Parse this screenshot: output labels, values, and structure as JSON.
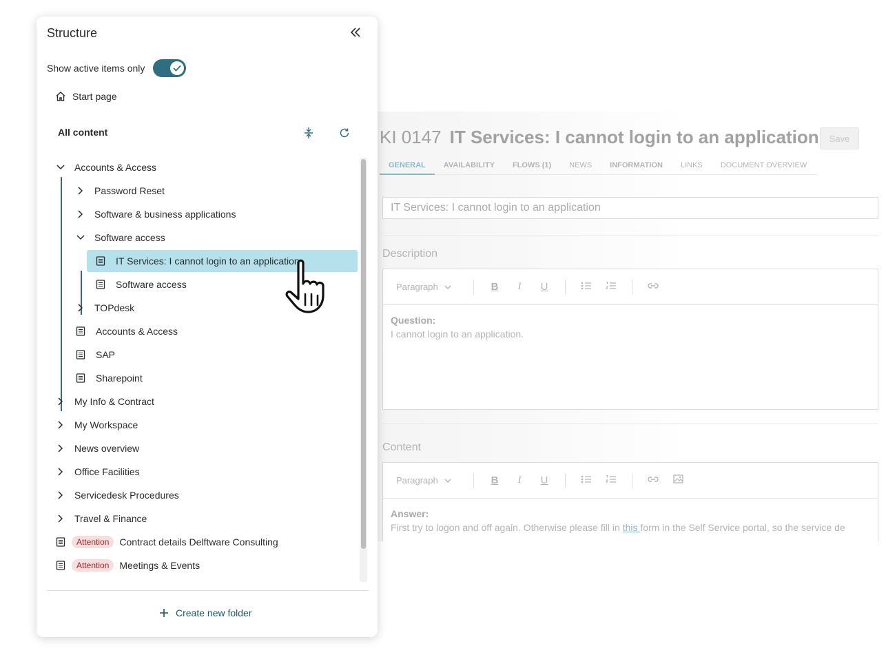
{
  "editor": {
    "id": "KI 0147",
    "title": "IT Services: I cannot login to an application",
    "save_label": "Save",
    "tabs": [
      "GENERAL",
      "AVAILABILITY",
      "FLOWS (1)",
      "NEWS",
      "INFORMATION",
      "LINKS",
      "DOCUMENT OVERVIEW"
    ],
    "title_field_value": "IT Services: I cannot login to an application",
    "description_label": "Description",
    "content_label": "Content",
    "toolbar_style": "Paragraph",
    "description_heading": "Question:",
    "description_text": "I cannot login to an application.",
    "content_heading": "Answer:",
    "content_text_before": "First try to logon and off again. Otherwise please fill in ",
    "content_link": "this ",
    "content_text_after": "form in the Self Service portal, so the service de"
  },
  "panel": {
    "title": "Structure",
    "toggle_label": "Show active items only",
    "toggle_on": true,
    "start_page": "Start page",
    "all_content": "All content",
    "create_folder": "Create new folder",
    "accent_color": "#2e6e80",
    "selected_color": "#b4e1ec"
  },
  "tree": [
    {
      "label": "Accounts & Access",
      "kind": "folder",
      "expanded": true
    },
    {
      "label": "Password Reset",
      "kind": "folder",
      "expanded": false
    },
    {
      "label": "Software & business applications",
      "kind": "folder",
      "expanded": false
    },
    {
      "label": "Software access",
      "kind": "folder",
      "expanded": true
    },
    {
      "label": "IT Services: I cannot login to an application",
      "kind": "document",
      "selected": true
    },
    {
      "label": "Software access",
      "kind": "document"
    },
    {
      "label": "TOPdesk",
      "kind": "folder",
      "expanded": false
    },
    {
      "label": "Accounts & Access",
      "kind": "document"
    },
    {
      "label": "SAP",
      "kind": "document"
    },
    {
      "label": "Sharepoint",
      "kind": "document"
    },
    {
      "label": "My Info & Contract",
      "kind": "folder",
      "expanded": false
    },
    {
      "label": "My Workspace",
      "kind": "folder",
      "expanded": false
    },
    {
      "label": "News overview",
      "kind": "folder",
      "expanded": false
    },
    {
      "label": "Office Facilities",
      "kind": "folder",
      "expanded": false
    },
    {
      "label": "Servicedesk Procedures",
      "kind": "folder",
      "expanded": false
    },
    {
      "label": "Travel & Finance",
      "kind": "folder",
      "expanded": false
    },
    {
      "label": "Contract details Delftware Consulting",
      "kind": "document",
      "badge": "Attention"
    },
    {
      "label": "Meetings & Events",
      "kind": "document",
      "badge": "Attention"
    }
  ]
}
